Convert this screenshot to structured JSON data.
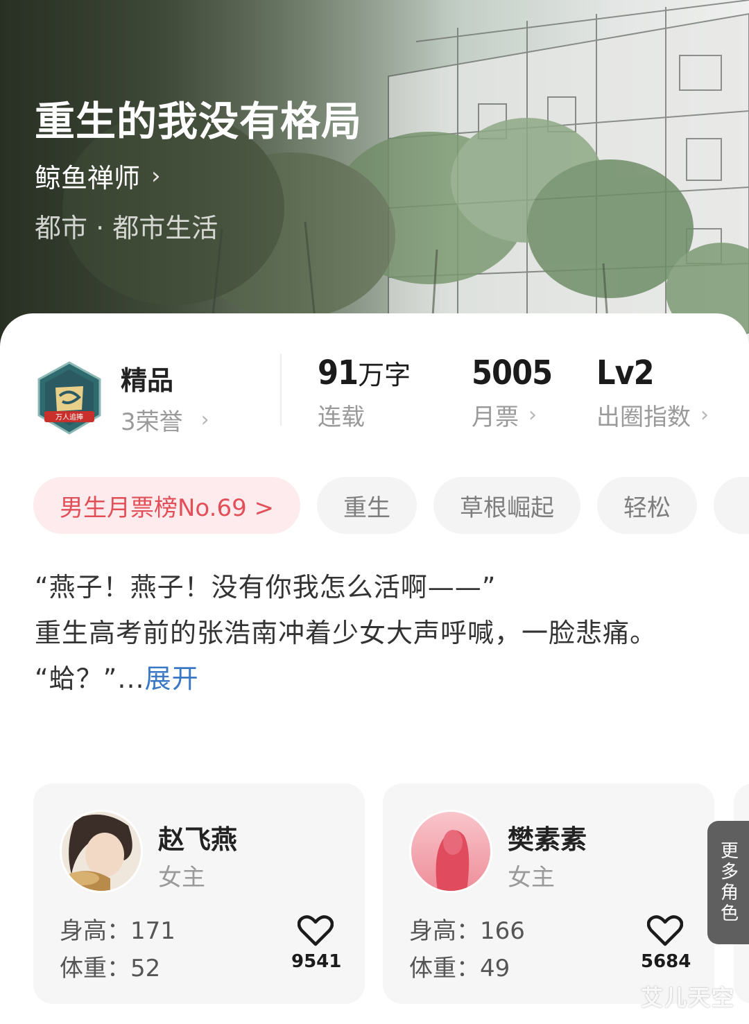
{
  "book": {
    "title": "重生的我没有格局",
    "author": "鲸鱼禅师",
    "genre": "都市 · 都市生活"
  },
  "honor": {
    "title": "精品",
    "subtitle": "3荣誉",
    "badge_text": "万人追捧"
  },
  "stats": [
    {
      "value": "91",
      "unit": "万字",
      "label": "连载"
    },
    {
      "value": "5005",
      "unit": "",
      "label": "月票"
    },
    {
      "value": "Lv2",
      "unit": "",
      "label": "出圈指数"
    }
  ],
  "tags": [
    "男生月票榜No.69 >",
    "重生",
    "草根崛起",
    "轻松"
  ],
  "synopsis": {
    "line1": "“燕子！燕子！没有你我怎么活啊——”",
    "line2": "重生高考前的张浩南冲着少女大声呼喊，一脸悲痛。",
    "line3": "“蛤？”...",
    "expand": "展开"
  },
  "characters": [
    {
      "name": "赵飞燕",
      "role": "女主",
      "height": "身高：171",
      "weight": "体重：52",
      "likes": "9541"
    },
    {
      "name": "樊素素",
      "role": "女主",
      "height": "身高：166",
      "weight": "体重：49",
      "likes": "5684"
    }
  ],
  "more_roles": "更多角色",
  "watermark": "艾儿天空",
  "colors": {
    "rank_tag_bg": "#fdebed",
    "rank_tag_text": "#e34f58",
    "expand_link": "#3a78c6"
  }
}
